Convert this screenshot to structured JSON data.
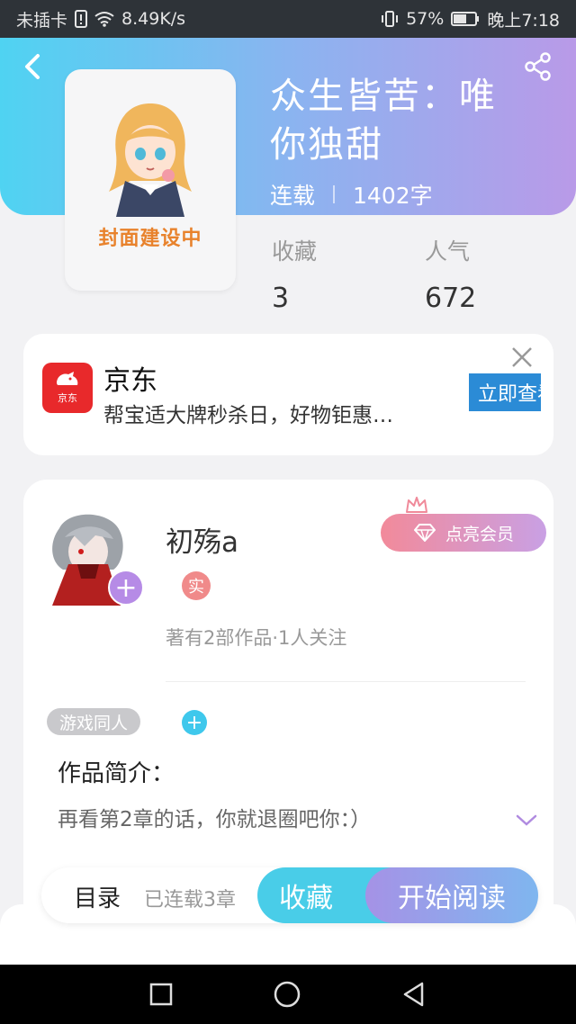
{
  "status_bar": {
    "carrier": "未插卡",
    "speed": "8.49K/s",
    "battery": "57%",
    "time": "晚上7:18"
  },
  "header": {
    "back_icon": "back-arrow-icon",
    "share_icon": "share-icon",
    "cover_caption": "封面建设中",
    "title_line1": "众生皆苦：唯",
    "title_line2": "你独甜",
    "status": "连载",
    "word_count": "1402字"
  },
  "stats": {
    "favorites_label": "收藏",
    "favorites_value": "3",
    "popularity_label": "人气",
    "popularity_value": "672"
  },
  "ad": {
    "brand": "京东",
    "logo_text": "京东",
    "description": "帮宝适大牌秒杀日，好物钜惠…",
    "cta": "立即查看"
  },
  "author": {
    "name": "初殇a",
    "verified_badge": "实",
    "stats": "著有2部作品·1人关注",
    "vip_button": "点亮会员"
  },
  "tags": [
    "游戏同人"
  ],
  "intro": {
    "title": "作品简介：",
    "text": "再看第2章的话，你就退圈吧你：）"
  },
  "actions": {
    "toc": "目录",
    "toc_sub": "已连载3章",
    "favorite": "收藏",
    "start_reading": "开始阅读"
  },
  "colors": {
    "gradient_start": "#4fd3f2",
    "gradient_end": "#b99ae8",
    "jd_red": "#e8292b",
    "ad_button": "#2b8bd6",
    "favorite_button": "#49cde8"
  }
}
